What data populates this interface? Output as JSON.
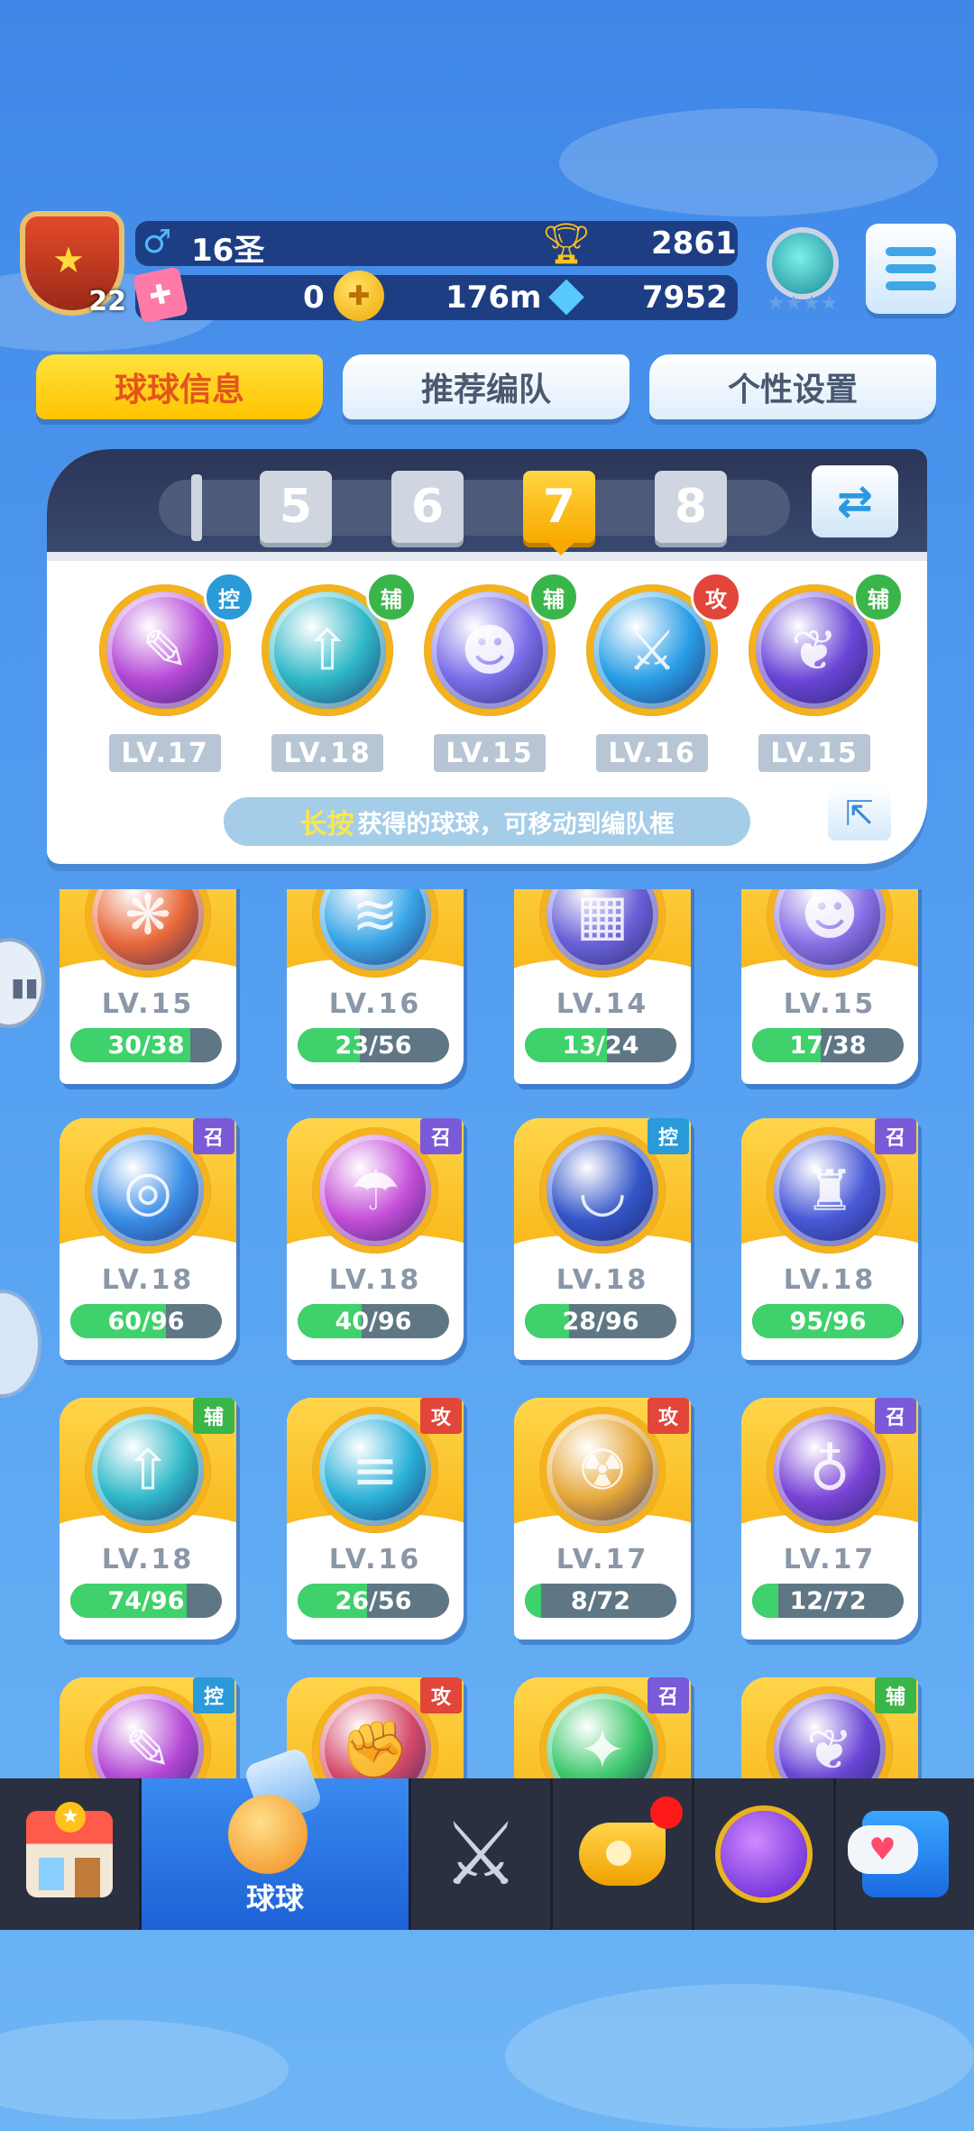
{
  "player": {
    "level": "22",
    "gender_icon": "male-icon",
    "rank": "16圣",
    "trophies": "2861",
    "tickets": "0",
    "coins": "176m",
    "diamonds": "7952"
  },
  "tabs": [
    {
      "label": "球球信息",
      "active": true
    },
    {
      "label": "推荐编队",
      "active": false
    },
    {
      "label": "个性设置",
      "active": false
    }
  ],
  "team_slots": {
    "items": [
      "5",
      "6",
      "7",
      "8"
    ],
    "active": "7"
  },
  "team": [
    {
      "role": "控",
      "role_color": "#2a9ad8",
      "level": "LV.17",
      "color": "#b448d6",
      "glyph": "✎"
    },
    {
      "role": "辅",
      "role_color": "#3ab54a",
      "level": "LV.18",
      "color": "#2fb8c8",
      "glyph": "⇧"
    },
    {
      "role": "辅",
      "role_color": "#3ab54a",
      "level": "LV.15",
      "color": "#7a6ee8",
      "glyph": "☻"
    },
    {
      "role": "攻",
      "role_color": "#e2453a",
      "level": "LV.16",
      "color": "#2a9ee6",
      "glyph": "⚔"
    },
    {
      "role": "辅",
      "role_color": "#3ab54a",
      "level": "LV.15",
      "color": "#6a46d6",
      "glyph": "❦"
    }
  ],
  "hint": {
    "highlight": "长按",
    "text": "获得的球球，可移动到编队框"
  },
  "balls": [
    {
      "role": "",
      "role_color": "",
      "level": "LV.15",
      "progress": "30/38",
      "fill": 0.79,
      "color": "#e8683a",
      "glyph": "❋"
    },
    {
      "role": "",
      "role_color": "",
      "level": "LV.16",
      "progress": "23/56",
      "fill": 0.41,
      "color": "#3aa6e6",
      "glyph": "≋"
    },
    {
      "role": "",
      "role_color": "",
      "level": "LV.14",
      "progress": "13/24",
      "fill": 0.54,
      "color": "#6a62d8",
      "glyph": "▦"
    },
    {
      "role": "",
      "role_color": "",
      "level": "LV.15",
      "progress": "17/38",
      "fill": 0.45,
      "color": "#8a70e6",
      "glyph": "☻"
    },
    {
      "role": "召",
      "role_color": "#7a5ad8",
      "level": "LV.18",
      "progress": "60/96",
      "fill": 0.63,
      "color": "#3a8ee8",
      "glyph": "◎"
    },
    {
      "role": "召",
      "role_color": "#7a5ad8",
      "level": "LV.18",
      "progress": "40/96",
      "fill": 0.42,
      "color": "#c44ed8",
      "glyph": "☂"
    },
    {
      "role": "控",
      "role_color": "#2a9ad8",
      "level": "LV.18",
      "progress": "28/96",
      "fill": 0.29,
      "color": "#3456c8",
      "glyph": "◡"
    },
    {
      "role": "召",
      "role_color": "#7a5ad8",
      "level": "LV.18",
      "progress": "95/96",
      "fill": 0.99,
      "color": "#4a5ad8",
      "glyph": "♜"
    },
    {
      "role": "辅",
      "role_color": "#3ab54a",
      "level": "LV.18",
      "progress": "74/96",
      "fill": 0.77,
      "color": "#2fb8c8",
      "glyph": "⇧"
    },
    {
      "role": "攻",
      "role_color": "#e2453a",
      "level": "LV.16",
      "progress": "26/56",
      "fill": 0.46,
      "color": "#2ab0d8",
      "glyph": "≡"
    },
    {
      "role": "攻",
      "role_color": "#e2453a",
      "level": "LV.17",
      "progress": "8/72",
      "fill": 0.11,
      "color": "#e6a83a",
      "glyph": "☢"
    },
    {
      "role": "召",
      "role_color": "#7a5ad8",
      "level": "LV.17",
      "progress": "12/72",
      "fill": 0.17,
      "color": "#7a44d6",
      "glyph": "♁"
    },
    {
      "role": "控",
      "role_color": "#2a9ad8",
      "level": "",
      "progress": "",
      "fill": 0,
      "color": "#b448d6",
      "glyph": "✎"
    },
    {
      "role": "攻",
      "role_color": "#e2453a",
      "level": "",
      "progress": "",
      "fill": 0,
      "color": "#d64a6a",
      "glyph": "✊"
    },
    {
      "role": "召",
      "role_color": "#7a5ad8",
      "level": "",
      "progress": "",
      "fill": 0,
      "color": "#3ac86a",
      "glyph": "✦"
    },
    {
      "role": "辅",
      "role_color": "#3ab54a",
      "level": "",
      "progress": "",
      "fill": 0,
      "color": "#6a46d6",
      "glyph": "❦"
    }
  ],
  "nav": [
    {
      "name": "shop-icon",
      "label": ""
    },
    {
      "name": "ball-cannon-icon",
      "label": "球球"
    },
    {
      "name": "crossed-swords-icon",
      "label": ""
    },
    {
      "name": "whistle-icon",
      "label": "",
      "badge": true
    },
    {
      "name": "planet-icon",
      "label": ""
    },
    {
      "name": "chat-heart-icon",
      "label": ""
    }
  ]
}
